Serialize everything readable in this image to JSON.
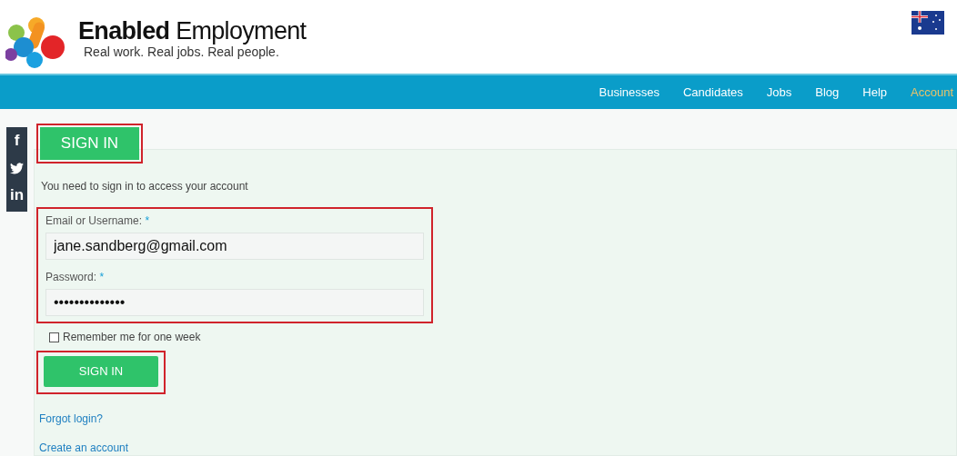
{
  "brand": {
    "name_bold": "Enabled",
    "name_rest": "Employment",
    "tagline": "Real work. Real jobs. Real people."
  },
  "nav": [
    {
      "label": "Businesses",
      "selected": false
    },
    {
      "label": "Candidates",
      "selected": false
    },
    {
      "label": "Jobs",
      "selected": false
    },
    {
      "label": "Blog",
      "selected": false
    },
    {
      "label": "Help",
      "selected": false
    },
    {
      "label": "Account",
      "selected": true
    }
  ],
  "social": [
    {
      "kind": "facebook",
      "label": "f"
    },
    {
      "kind": "twitter"
    },
    {
      "kind": "linkedin",
      "label": "in"
    }
  ],
  "tab": {
    "label": "SIGN IN"
  },
  "intro": "You need to sign in to access your account",
  "fields": [
    {
      "label": "Email or Username:",
      "required_mark": "*",
      "value": "jane.sandberg@gmail.com"
    },
    {
      "label": "Password:",
      "required_mark": "*",
      "value": "••••••••••••••"
    }
  ],
  "remember": {
    "label": "Remember me for one week",
    "checked": false
  },
  "submit": {
    "label": "SIGN IN"
  },
  "links": [
    "Forgot login?",
    "Create an account"
  ]
}
